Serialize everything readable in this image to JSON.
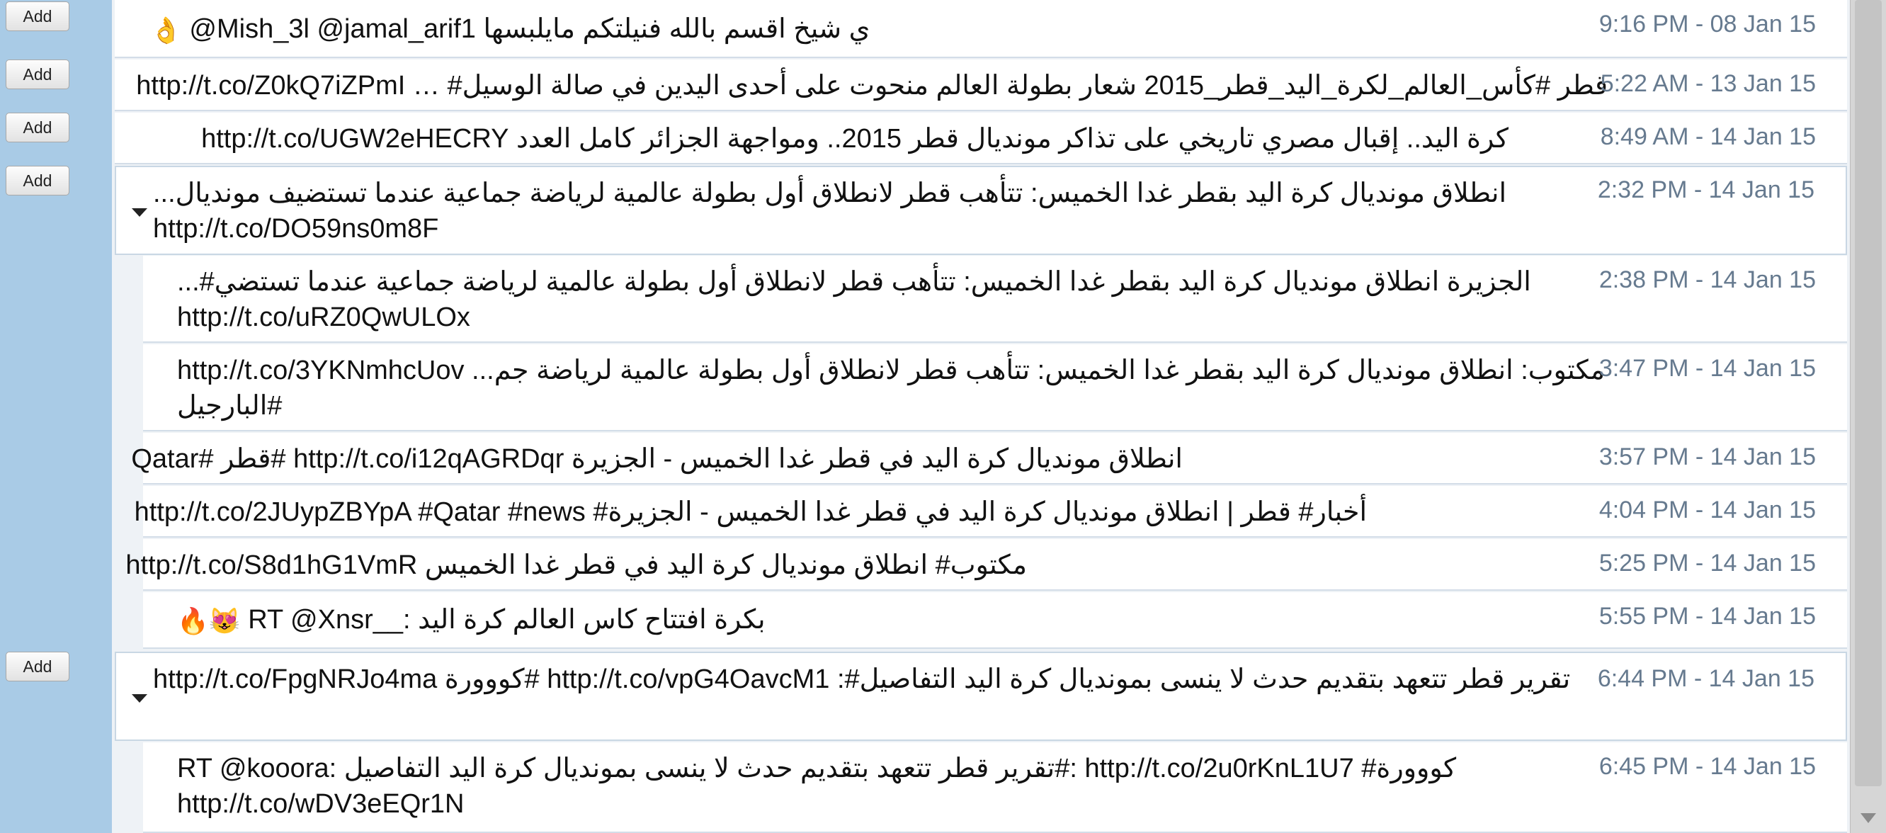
{
  "colors": {
    "background": "#a9cbe6",
    "row": "#ffffff",
    "timestamp": "#667a8f"
  },
  "buttons": {
    "add_label": "Add"
  },
  "rows": [
    {
      "text": "@Mish_3l @jamal_arif1 ي شيخ اقسم بالله فنيلتكم مايلبسها",
      "emoji": "👌",
      "time": "9:16 PM - 08 Jan 15"
    },
    {
      "text": "قطر #كأس_العالم_لكرة_اليد_قطر_2015 شعار بطولة العالم منحوت على أحدى اليدين في صالة الوسيل# … http://t.co/Z0kQ7iZPmI",
      "time": "5:22 AM - 13 Jan 15"
    },
    {
      "text": "كرة اليد.. إقبال مصري تاريخي على تذاكر مونديال قطر 2015.. ومواجهة الجزائر كامل العدد http://t.co/UGW2eHECRY",
      "time": "8:49 AM - 14 Jan 15"
    },
    {
      "text": "انطلاق مونديال كرة اليد بقطر غدا الخميس: تتأهب قطر لانطلاق أول بطولة عالمية لرياضة جماعية عندما تستضيف مونديال... http://t.co/DO59ns0m8F",
      "time": "2:32 PM - 14 Jan 15"
    },
    {
      "text": "الجزيرة انطلاق مونديال كرة اليد بقطر غدا الخميس: تتأهب قطر لانطلاق أول بطولة عالمية لرياضة جماعية عندما تستضي#... http://t.co/uRZ0QwULOx",
      "time": "2:38 PM - 14 Jan 15"
    },
    {
      "text": "مكتوب: انطلاق مونديال كرة اليد بقطر غدا الخميس: تتأهب قطر لانطلاق أول بطولة عالمية لرياضة جم... http://t.co/3YKNmhcUov #البارجيل",
      "time": "3:47 PM - 14 Jan 15"
    },
    {
      "text": "انطلاق مونديال كرة اليد في قطر غدا الخميس - الجزيرة http://t.co/i12qAGRDqr #قطر #Qatar",
      "time": "3:57 PM - 14 Jan 15"
    },
    {
      "text": "أخبار# قطر | انطلاق مونديال كرة اليد في قطر غدا الخميس - الجزيرة# http://t.co/2JUypZBYpA #Qatar #news",
      "time": "4:04 PM - 14 Jan 15"
    },
    {
      "text": "مكتوب# انطلاق مونديال كرة اليد في قطر غدا الخميس http://t.co/S8d1hG1VmR",
      "time": "5:25 PM - 14 Jan 15"
    },
    {
      "text": "RT @Xnsr__: بكرة افتتاح كاس العالم كرة اليد",
      "emoji": "😻🔥",
      "time": "5:55 PM - 14 Jan 15"
    },
    {
      "text": "تقرير قطر تتعهد بتقديم حدث لا ينسى بمونديال كرة اليد التفاصيل#: http://t.co/vpG4OavcM1 #كووورة http://t.co/FpgNRJo4ma",
      "time": "6:44 PM - 14 Jan 15"
    },
    {
      "text": "RT @kooora: تقرير قطر تتعهد بتقديم حدث لا ينسى بمونديال كرة اليد التفاصيل#: http://t.co/2u0rKnL1U7 #كووورة http://t.co/wDV3eEQr1N",
      "time": "6:45 PM - 14 Jan 15"
    }
  ]
}
